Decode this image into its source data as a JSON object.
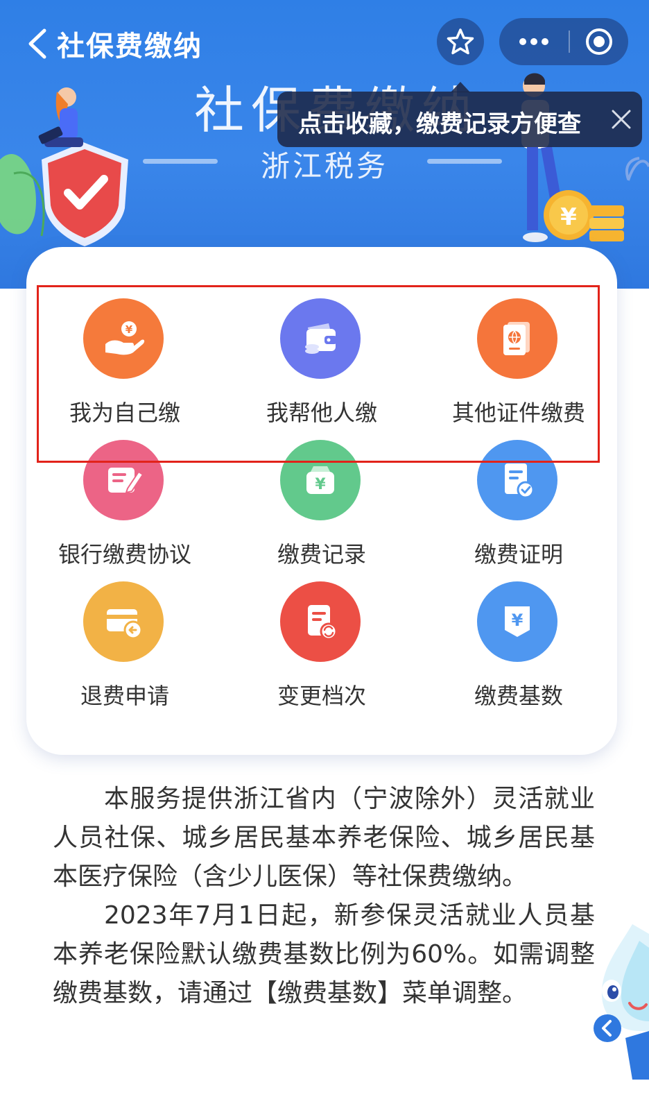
{
  "nav": {
    "title": "社保费缴纳"
  },
  "hero": {
    "title": "社保费缴纳",
    "subtitle": "浙江税务"
  },
  "tooltip": {
    "text": "点击收藏，缴费记录方便查"
  },
  "menu": {
    "items": [
      {
        "label": "我为自己缴",
        "icon": "hand-coin-icon",
        "color": "#f57a3b"
      },
      {
        "label": "我帮他人缴",
        "icon": "wallet-icon",
        "color": "#6b78ee"
      },
      {
        "label": "其他证件缴费",
        "icon": "passport-icon",
        "color": "#f5753b"
      },
      {
        "label": "银行缴费协议",
        "icon": "edit-document-icon",
        "color": "#ec6486"
      },
      {
        "label": "缴费记录",
        "icon": "money-bag-icon",
        "color": "#62c98c"
      },
      {
        "label": "缴费证明",
        "icon": "certificate-icon",
        "color": "#4f97f0"
      },
      {
        "label": "退费申请",
        "icon": "refund-card-icon",
        "color": "#f2b246"
      },
      {
        "label": "变更档次",
        "icon": "change-level-icon",
        "color": "#ec4f45"
      },
      {
        "label": "缴费基数",
        "icon": "yuan-base-icon",
        "color": "#4f97f0"
      }
    ]
  },
  "description": {
    "paragraph1": "本服务提供浙江省内（宁波除外）灵活就业人员社保、城乡居民基本养老保险、城乡居民基本医疗保险（含少儿医保）等社保费缴纳。",
    "paragraph2": "2023年7月1日起，新参保灵活就业人员基本养老保险默认缴费基数比例为60%。如需调整缴费基数，请通过【缴费基数】菜单调整。"
  }
}
